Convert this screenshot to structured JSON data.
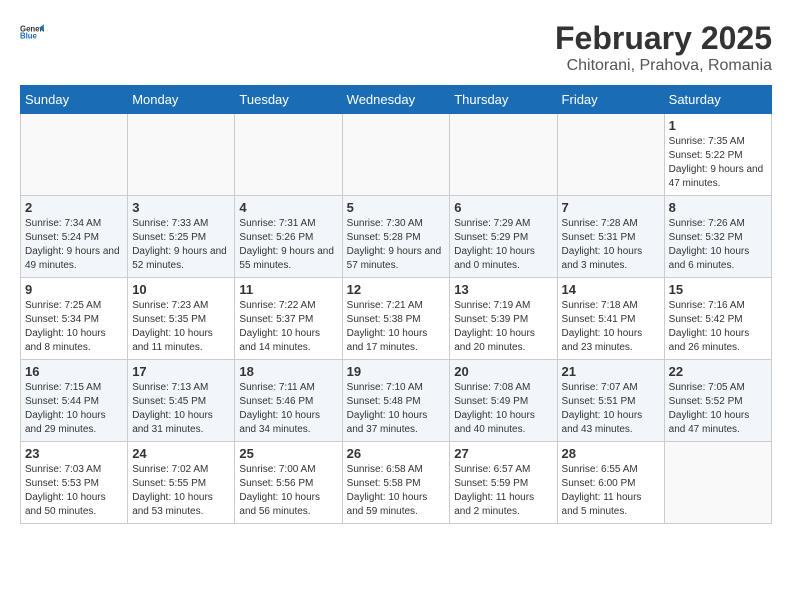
{
  "logo": {
    "general": "General",
    "blue": "Blue"
  },
  "title": "February 2025",
  "subtitle": "Chitorani, Prahova, Romania",
  "days_of_week": [
    "Sunday",
    "Monday",
    "Tuesday",
    "Wednesday",
    "Thursday",
    "Friday",
    "Saturday"
  ],
  "weeks": [
    [
      {
        "day": "",
        "info": ""
      },
      {
        "day": "",
        "info": ""
      },
      {
        "day": "",
        "info": ""
      },
      {
        "day": "",
        "info": ""
      },
      {
        "day": "",
        "info": ""
      },
      {
        "day": "",
        "info": ""
      },
      {
        "day": "1",
        "info": "Sunrise: 7:35 AM\nSunset: 5:22 PM\nDaylight: 9 hours and 47 minutes."
      }
    ],
    [
      {
        "day": "2",
        "info": "Sunrise: 7:34 AM\nSunset: 5:24 PM\nDaylight: 9 hours and 49 minutes."
      },
      {
        "day": "3",
        "info": "Sunrise: 7:33 AM\nSunset: 5:25 PM\nDaylight: 9 hours and 52 minutes."
      },
      {
        "day": "4",
        "info": "Sunrise: 7:31 AM\nSunset: 5:26 PM\nDaylight: 9 hours and 55 minutes."
      },
      {
        "day": "5",
        "info": "Sunrise: 7:30 AM\nSunset: 5:28 PM\nDaylight: 9 hours and 57 minutes."
      },
      {
        "day": "6",
        "info": "Sunrise: 7:29 AM\nSunset: 5:29 PM\nDaylight: 10 hours and 0 minutes."
      },
      {
        "day": "7",
        "info": "Sunrise: 7:28 AM\nSunset: 5:31 PM\nDaylight: 10 hours and 3 minutes."
      },
      {
        "day": "8",
        "info": "Sunrise: 7:26 AM\nSunset: 5:32 PM\nDaylight: 10 hours and 6 minutes."
      }
    ],
    [
      {
        "day": "9",
        "info": "Sunrise: 7:25 AM\nSunset: 5:34 PM\nDaylight: 10 hours and 8 minutes."
      },
      {
        "day": "10",
        "info": "Sunrise: 7:23 AM\nSunset: 5:35 PM\nDaylight: 10 hours and 11 minutes."
      },
      {
        "day": "11",
        "info": "Sunrise: 7:22 AM\nSunset: 5:37 PM\nDaylight: 10 hours and 14 minutes."
      },
      {
        "day": "12",
        "info": "Sunrise: 7:21 AM\nSunset: 5:38 PM\nDaylight: 10 hours and 17 minutes."
      },
      {
        "day": "13",
        "info": "Sunrise: 7:19 AM\nSunset: 5:39 PM\nDaylight: 10 hours and 20 minutes."
      },
      {
        "day": "14",
        "info": "Sunrise: 7:18 AM\nSunset: 5:41 PM\nDaylight: 10 hours and 23 minutes."
      },
      {
        "day": "15",
        "info": "Sunrise: 7:16 AM\nSunset: 5:42 PM\nDaylight: 10 hours and 26 minutes."
      }
    ],
    [
      {
        "day": "16",
        "info": "Sunrise: 7:15 AM\nSunset: 5:44 PM\nDaylight: 10 hours and 29 minutes."
      },
      {
        "day": "17",
        "info": "Sunrise: 7:13 AM\nSunset: 5:45 PM\nDaylight: 10 hours and 31 minutes."
      },
      {
        "day": "18",
        "info": "Sunrise: 7:11 AM\nSunset: 5:46 PM\nDaylight: 10 hours and 34 minutes."
      },
      {
        "day": "19",
        "info": "Sunrise: 7:10 AM\nSunset: 5:48 PM\nDaylight: 10 hours and 37 minutes."
      },
      {
        "day": "20",
        "info": "Sunrise: 7:08 AM\nSunset: 5:49 PM\nDaylight: 10 hours and 40 minutes."
      },
      {
        "day": "21",
        "info": "Sunrise: 7:07 AM\nSunset: 5:51 PM\nDaylight: 10 hours and 43 minutes."
      },
      {
        "day": "22",
        "info": "Sunrise: 7:05 AM\nSunset: 5:52 PM\nDaylight: 10 hours and 47 minutes."
      }
    ],
    [
      {
        "day": "23",
        "info": "Sunrise: 7:03 AM\nSunset: 5:53 PM\nDaylight: 10 hours and 50 minutes."
      },
      {
        "day": "24",
        "info": "Sunrise: 7:02 AM\nSunset: 5:55 PM\nDaylight: 10 hours and 53 minutes."
      },
      {
        "day": "25",
        "info": "Sunrise: 7:00 AM\nSunset: 5:56 PM\nDaylight: 10 hours and 56 minutes."
      },
      {
        "day": "26",
        "info": "Sunrise: 6:58 AM\nSunset: 5:58 PM\nDaylight: 10 hours and 59 minutes."
      },
      {
        "day": "27",
        "info": "Sunrise: 6:57 AM\nSunset: 5:59 PM\nDaylight: 11 hours and 2 minutes."
      },
      {
        "day": "28",
        "info": "Sunrise: 6:55 AM\nSunset: 6:00 PM\nDaylight: 11 hours and 5 minutes."
      },
      {
        "day": "",
        "info": ""
      }
    ]
  ]
}
